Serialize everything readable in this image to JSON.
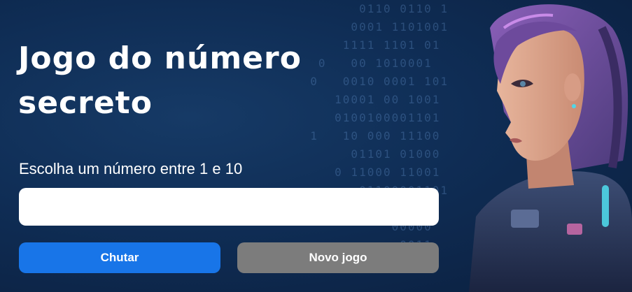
{
  "page": {
    "title": "Jogo do número secreto",
    "prompt": "Escolha um número entre 1 e 10",
    "guess_input": {
      "value": "",
      "placeholder": ""
    },
    "buttons": {
      "guess_label": "Chutar",
      "new_game_label": "Novo jogo"
    }
  },
  "background": {
    "binary_lines": [
      "        0110 0110 1",
      "       0001 1101001",
      "      1111 1101 01",
      "   0   00 1010001",
      "  0   0010 0001 101",
      "     10001 00 1001",
      "     0100100001101",
      "  1   10 000 11100",
      "       01101 01000",
      "     0 11000 11001",
      "        01100001101",
      "      11010000 110",
      "            00000",
      "             0011",
      "         00 0111 0"
    ]
  },
  "colors": {
    "primary_button": "#1875e8",
    "secondary_button": "#7c7c7c",
    "text": "#ffffff"
  }
}
